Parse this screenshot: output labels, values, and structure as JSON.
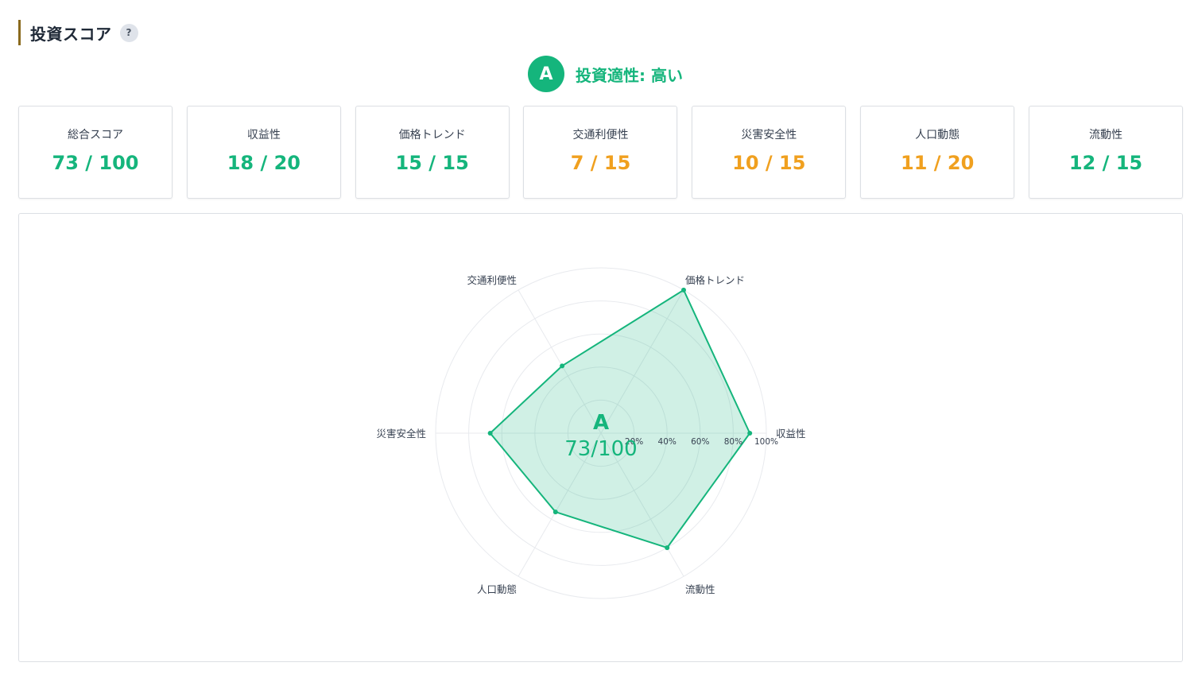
{
  "header": {
    "title": "投資スコア",
    "help_icon": "?"
  },
  "grade": {
    "letter": "A",
    "text": "投資適性: 高い",
    "color": "#15b57c"
  },
  "colors": {
    "good": "#15b57c",
    "warn": "#f0a01f",
    "accent_bar": "#8a6a1e"
  },
  "cards": [
    {
      "label": "総合スコア",
      "value": "73 / 100",
      "status": "good"
    },
    {
      "label": "収益性",
      "value": "18 / 20",
      "status": "good"
    },
    {
      "label": "価格トレンド",
      "value": "15 / 15",
      "status": "good"
    },
    {
      "label": "交通利便性",
      "value": "7 / 15",
      "status": "warn"
    },
    {
      "label": "災害安全性",
      "value": "10 / 15",
      "status": "warn"
    },
    {
      "label": "人口動態",
      "value": "11 / 20",
      "status": "warn"
    },
    {
      "label": "流動性",
      "value": "12 / 15",
      "status": "good"
    }
  ],
  "chart_data": {
    "type": "radar",
    "axes": [
      "収益性",
      "価格トレンド",
      "交通利便性",
      "災害安全性",
      "人口動態",
      "流動性"
    ],
    "values": [
      90,
      100,
      47,
      67,
      55,
      80
    ],
    "unit": "%",
    "range": [
      0,
      100
    ],
    "ticks": [
      "20%",
      "40%",
      "60%",
      "80%",
      "100%"
    ],
    "center_grade": "A",
    "center_score": "73/100",
    "line_color": "#15b57c",
    "fill_color": "#15b57c"
  }
}
